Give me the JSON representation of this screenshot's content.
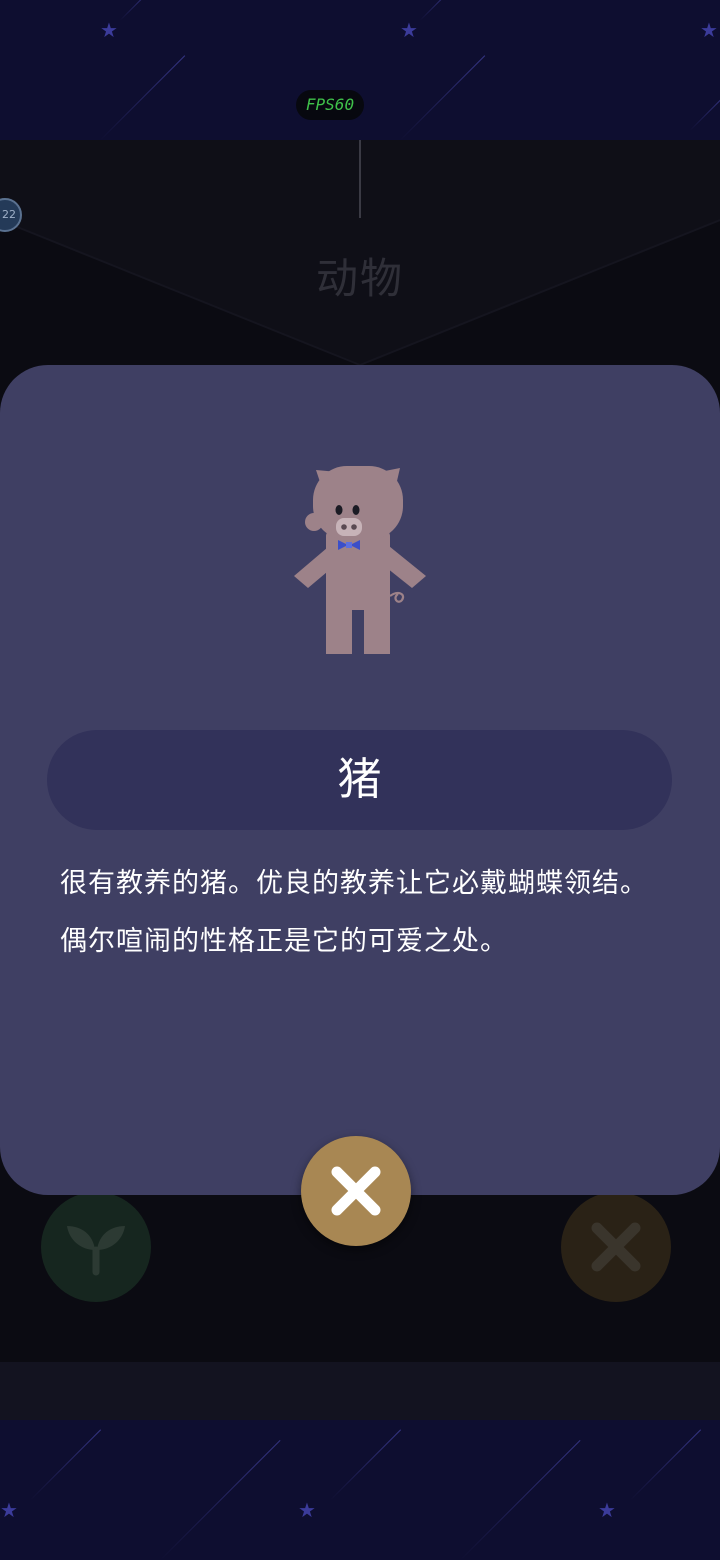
{
  "hud": {
    "fps_label": "FPS60"
  },
  "game": {
    "category_title": "动物",
    "level_badge": "22"
  },
  "card": {
    "animal_name": "猪",
    "description": "很有教养的猪。优良的教养让它必戴蝴蝶领结。偶尔喧闹的性格正是它的可爱之处。"
  },
  "buttons": {
    "close_icon": "close-icon",
    "sprout_icon": "sprout-icon",
    "cross_icon": "cross-icon"
  },
  "colors": {
    "card_bg": "#3f3f63",
    "name_pill_bg": "#32325a",
    "close_button": "#a88753",
    "pig_body": "#9d8289",
    "bowtie": "#3b4fc9",
    "fps_text": "#3fc04a"
  }
}
